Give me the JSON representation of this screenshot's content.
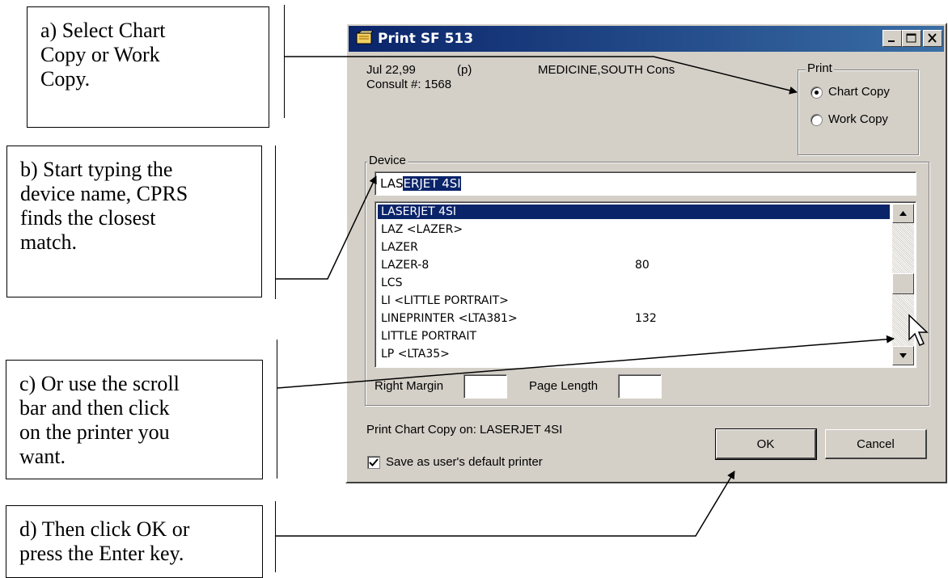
{
  "callouts": {
    "a": "a) Select Chart\nCopy or Work\nCopy.",
    "b": "b) Start typing the\ndevice name, CPRS\nfinds the closest\nmatch.",
    "c": "c) Or use the scroll\nbar and then click\non the printer you\nwant.",
    "d": "d) Then click OK or\npress the Enter key."
  },
  "window": {
    "title": "Print SF 513",
    "date": "Jul 22,99",
    "p_flag": "(p)",
    "service": "MEDICINE,SOUTH Cons",
    "consult": "Consult #: 1568",
    "print_group": {
      "label": "Print",
      "options": [
        "Chart Copy",
        "Work Copy"
      ],
      "selected": "Chart Copy"
    },
    "device_label": "Device",
    "device_input_typed": "LAS",
    "device_input_completion": "ERJET 4SI",
    "devices": [
      {
        "name": "LASERJET 4SI",
        "margin": ""
      },
      {
        "name": "LAZ  <LAZER>",
        "margin": ""
      },
      {
        "name": "LAZER",
        "margin": ""
      },
      {
        "name": "LAZER-8",
        "margin": "80"
      },
      {
        "name": "LCS",
        "margin": ""
      },
      {
        "name": "LI  <LITTLE PORTRAIT>",
        "margin": ""
      },
      {
        "name": "LINEPRINTER  <LTA381>",
        "margin": "132"
      },
      {
        "name": "LITTLE PORTRAIT",
        "margin": ""
      },
      {
        "name": "LP  <LTA35>",
        "margin": ""
      }
    ],
    "selected_device": "LASERJET 4SI",
    "right_margin_label": "Right Margin",
    "right_margin_value": "",
    "page_length_label": "Page Length",
    "page_length_value": "",
    "status": "Print Chart Copy on:  LASERJET 4SI",
    "ok_label": "OK",
    "cancel_label": "Cancel",
    "save_default_label": "Save as user's default printer",
    "save_default_checked": true
  }
}
